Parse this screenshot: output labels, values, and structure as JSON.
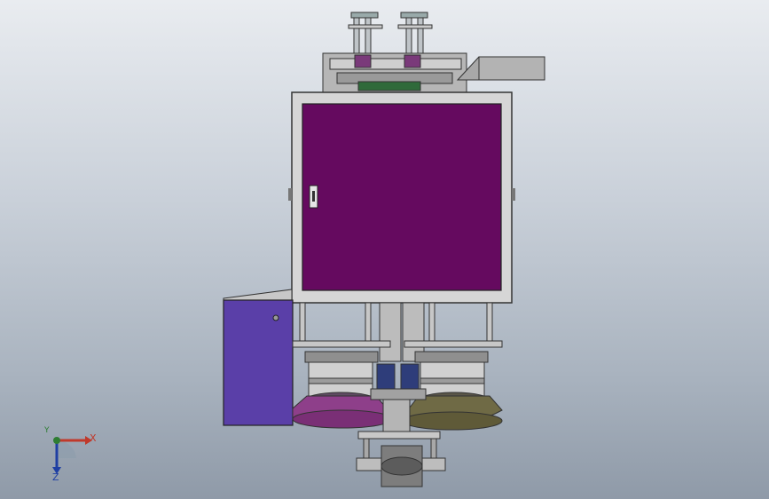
{
  "viewport": {
    "colors": {
      "background_top": "#e9ecf0",
      "background_bottom": "#8f9aa8",
      "cabinet_frame": "#d6d6d6",
      "cabinet_door": "#650a5f",
      "side_box": "#5a3fa8",
      "left_bowl": "#8e3f8a",
      "right_bowl": "#6f6a45",
      "gray_body": "#b9b9b9"
    },
    "icons": [
      "door-handle-icon",
      "keyhole-icon"
    ]
  },
  "triad": {
    "x_label": "X",
    "y_label": "Y",
    "z_label": "Z",
    "colors": {
      "x": "#c0392b",
      "y": "#2e7d32",
      "z": "#1f3fa3"
    }
  }
}
